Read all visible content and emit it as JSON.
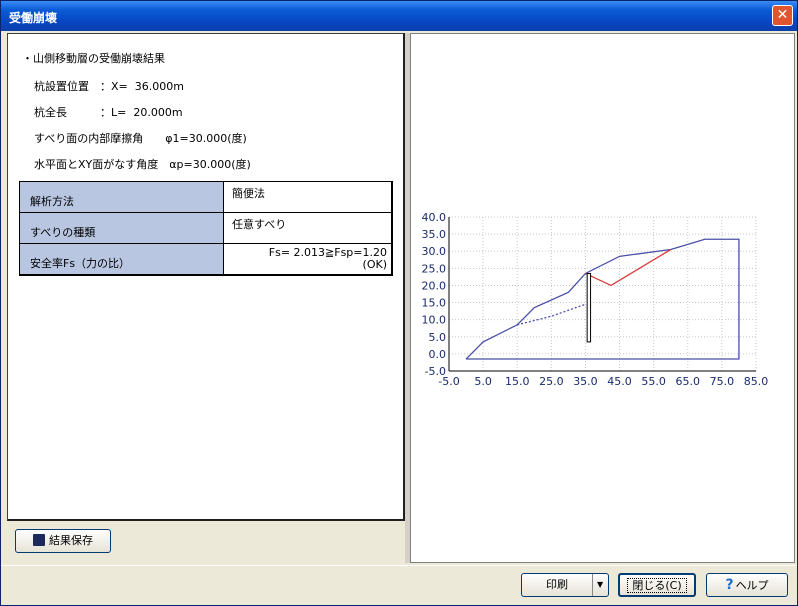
{
  "window": {
    "title": "受働崩壊",
    "close_glyph": "✕"
  },
  "info": {
    "heading": "・山側移動層の受働崩壊結果",
    "pile_position": "杭設置位置　：X=  36.000m",
    "pile_length": "杭全長　　　：L=  20.000m",
    "friction_angle": "すべり面の内部摩擦角　　φ1=30.000(度)",
    "plane_angle": "水平面とXY面がなす角度　αp=30.000(度)"
  },
  "table": {
    "rows": [
      {
        "label": "解析方法",
        "value": "簡便法"
      },
      {
        "label": "すべりの種類",
        "value": "任意すべり"
      },
      {
        "label": "安全率Fs（力の比）",
        "value": "Fs=  2.013≧Fsp=1.20",
        "value2": "(OK)"
      }
    ]
  },
  "buttons": {
    "save": "結果保存",
    "print": "印刷",
    "close": "閉じる(C)",
    "help": "ヘルプ"
  },
  "chart_data": {
    "type": "line",
    "xlim": [
      -5,
      85
    ],
    "ylim": [
      -5,
      40
    ],
    "xticks": [
      -5,
      5,
      15,
      25,
      35,
      45,
      55,
      65,
      75,
      85
    ],
    "yticks": [
      -5,
      0,
      5,
      10,
      15,
      20,
      25,
      30,
      35,
      40
    ],
    "xtick_labels": [
      "-5.0",
      "5.0",
      "15.0",
      "25.0",
      "35.0",
      "45.0",
      "55.0",
      "65.0",
      "75.0",
      "85.0"
    ],
    "ytick_labels": [
      "-5.0",
      "0.0",
      "5.0",
      "10.0",
      "15.0",
      "20.0",
      "25.0",
      "30.0",
      "35.0",
      "40.0"
    ],
    "grid": true,
    "series": [
      {
        "style": "solid",
        "color": "#4a4fa8",
        "x": [
          0,
          5,
          15,
          20,
          30,
          35,
          45,
          60,
          70,
          80,
          80,
          0
        ],
        "y": [
          -1.5,
          3.5,
          8.5,
          13.5,
          18,
          23.5,
          28.5,
          30.5,
          33.5,
          33.5,
          -1.5,
          -1.5
        ]
      },
      {
        "style": "dashed",
        "color": "#4a4fa8",
        "x": [
          15,
          25,
          35
        ],
        "y": [
          8.5,
          11,
          14.5
        ]
      },
      {
        "style": "solid",
        "color": "#d83a3a",
        "x": [
          35,
          42.5,
          60
        ],
        "y": [
          23.5,
          20,
          30.5
        ]
      }
    ],
    "pile": {
      "x": 36,
      "top": 23.5,
      "bottom": 3.5,
      "width": 1,
      "color": "#000000"
    }
  }
}
